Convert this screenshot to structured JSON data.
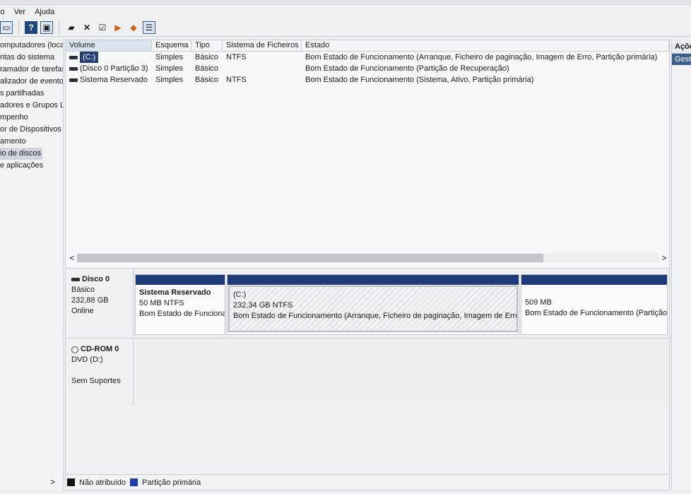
{
  "menu": [
    "io",
    "Ver",
    "Ajuda"
  ],
  "toolbar": [
    "back-icon",
    "help-icon",
    "view-icon",
    "comment-icon",
    "delete-icon",
    "check-icon",
    "export-icon",
    "import-icon",
    "properties-icon"
  ],
  "nav": {
    "items": [
      "omputadores (loca",
      "ntas do sistema",
      "ramador de tarefas",
      "alizador de eventos",
      "s partilhadas",
      "adores e Grupos Lc",
      "mpenho",
      "or de Dispositivos",
      "amento",
      "io de discos",
      "e aplicações"
    ],
    "selected_index": 9,
    "scroll_arrow": ">"
  },
  "volumes": {
    "headers": [
      "Volume",
      "Esquema",
      "Tipo",
      "Sistema de Ficheiros",
      "Estado"
    ],
    "rows": [
      {
        "volume": "(C:)",
        "esquema": "Simples",
        "tipo": "Básico",
        "fs": "NTFS",
        "estado": "Bom Estado de Funcionamento (Arranque, Ficheiro de paginação, Imagem de Erro, Partição primária)"
      },
      {
        "volume": "(Disco 0 Partição 3)",
        "esquema": "Simples",
        "tipo": "Básico",
        "fs": "",
        "estado": "Bom Estado de Funcionamento (Partição de Recuperação)"
      },
      {
        "volume": "Sistema Reservado",
        "esquema": "Simples",
        "tipo": "Básico",
        "fs": "NTFS",
        "estado": "Bom Estado de Funcionamento (Sistema, Ativo, Partição primária)"
      }
    ]
  },
  "scroll": {
    "left": "<",
    "right": ">"
  },
  "disks": {
    "disk0": {
      "name": "Disco 0",
      "type": "Básico",
      "size": "232,88 GB",
      "status": "Online",
      "partitions": [
        {
          "name": "Sistema Reservado",
          "size": "50 MB NTFS",
          "status": "Bom Estado de Funcionamento (Sistema, Ativo, Partição primária)"
        },
        {
          "name": "(C:)",
          "size": "232,34 GB NTFS",
          "status": "Bom Estado de Funcionamento (Arranque, Ficheiro de paginação, Imagem de Erro, Partição primária)"
        },
        {
          "name": "",
          "size": "509 MB",
          "status": "Bom Estado de Funcionamento (Partição de Recuperação)"
        }
      ]
    },
    "cdrom0": {
      "name": "CD-ROM 0",
      "drive": "DVD (D:)",
      "status": "Sem Suportes"
    }
  },
  "legend": {
    "unallocated": "Não atribuído",
    "primary": "Partição primária",
    "unallocated_color": "#111111",
    "primary_color": "#1f3fa8"
  },
  "actions": {
    "title": "Ações",
    "group": "Gestão de discos"
  }
}
